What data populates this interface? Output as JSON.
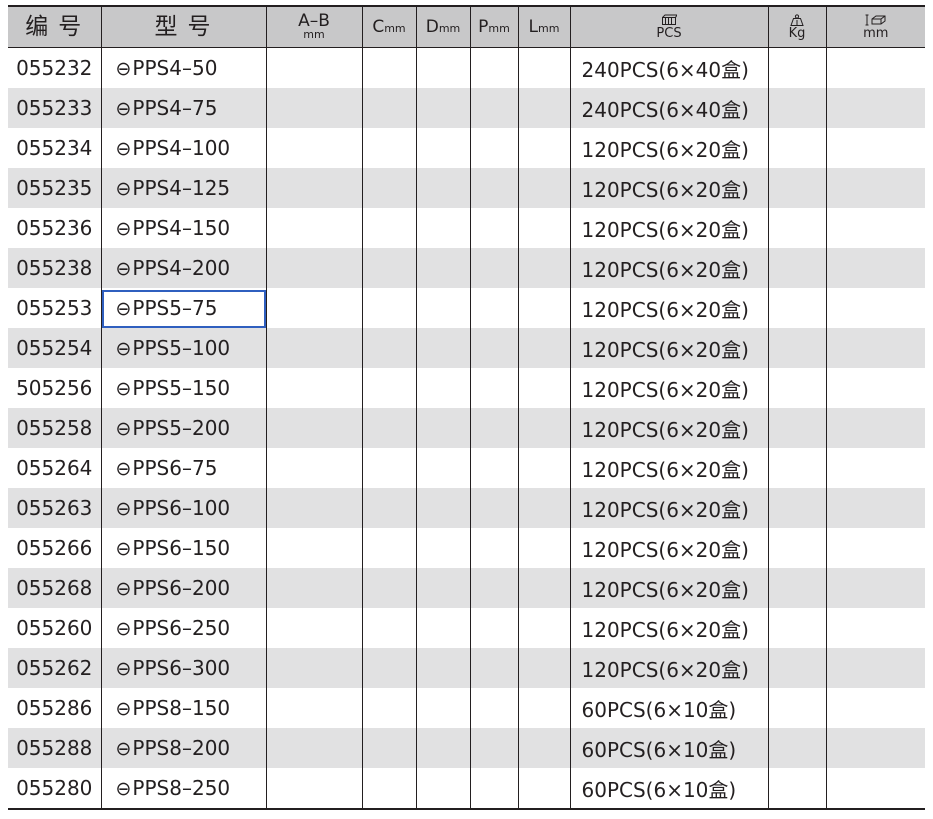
{
  "header": {
    "code": "编号",
    "model": "型号",
    "ab_main": "A–B",
    "ab_unit": "mm",
    "c_main": "C",
    "c_unit": "mm",
    "d_main": "D",
    "d_unit": "mm",
    "p_main": "P",
    "p_unit": "mm",
    "l_main": "L",
    "l_unit": "mm",
    "pcs_label": "PCS",
    "pcs_icon": "box-pack-icon",
    "kg_label": "Kg",
    "kg_icon": "weight-icon",
    "size_label": "mm",
    "size_icon": "carton-size-icon"
  },
  "model_symbol": "⊖",
  "rows": [
    {
      "code": "055232",
      "model": "PPS4–50",
      "ab": "",
      "c": "",
      "d": "",
      "p": "",
      "l": "",
      "pcs": "240PCS(6×40盒)",
      "kg": "",
      "size": ""
    },
    {
      "code": "055233",
      "model": "PPS4–75",
      "ab": "",
      "c": "",
      "d": "",
      "p": "",
      "l": "",
      "pcs": "240PCS(6×40盒)",
      "kg": "",
      "size": ""
    },
    {
      "code": "055234",
      "model": "PPS4–100",
      "ab": "",
      "c": "",
      "d": "",
      "p": "",
      "l": "",
      "pcs": "120PCS(6×20盒)",
      "kg": "",
      "size": ""
    },
    {
      "code": "055235",
      "model": "PPS4–125",
      "ab": "",
      "c": "",
      "d": "",
      "p": "",
      "l": "",
      "pcs": "120PCS(6×20盒)",
      "kg": "",
      "size": ""
    },
    {
      "code": "055236",
      "model": "PPS4–150",
      "ab": "",
      "c": "",
      "d": "",
      "p": "",
      "l": "",
      "pcs": "120PCS(6×20盒)",
      "kg": "",
      "size": ""
    },
    {
      "code": "055238",
      "model": "PPS4–200",
      "ab": "",
      "c": "",
      "d": "",
      "p": "",
      "l": "",
      "pcs": "120PCS(6×20盒)",
      "kg": "",
      "size": ""
    },
    {
      "code": "055253",
      "model": "PPS5–75",
      "ab": "",
      "c": "",
      "d": "",
      "p": "",
      "l": "",
      "pcs": "120PCS(6×20盒)",
      "kg": "",
      "size": ""
    },
    {
      "code": "055254",
      "model": "PPS5–100",
      "ab": "",
      "c": "",
      "d": "",
      "p": "",
      "l": "",
      "pcs": "120PCS(6×20盒)",
      "kg": "",
      "size": ""
    },
    {
      "code": "505256",
      "model": "PPS5–150",
      "ab": "",
      "c": "",
      "d": "",
      "p": "",
      "l": "",
      "pcs": "120PCS(6×20盒)",
      "kg": "",
      "size": ""
    },
    {
      "code": "055258",
      "model": "PPS5–200",
      "ab": "",
      "c": "",
      "d": "",
      "p": "",
      "l": "",
      "pcs": "120PCS(6×20盒)",
      "kg": "",
      "size": ""
    },
    {
      "code": "055264",
      "model": "PPS6–75",
      "ab": "",
      "c": "",
      "d": "",
      "p": "",
      "l": "",
      "pcs": "120PCS(6×20盒)",
      "kg": "",
      "size": ""
    },
    {
      "code": "055263",
      "model": "PPS6–100",
      "ab": "",
      "c": "",
      "d": "",
      "p": "",
      "l": "",
      "pcs": "120PCS(6×20盒)",
      "kg": "",
      "size": ""
    },
    {
      "code": "055266",
      "model": "PPS6–150",
      "ab": "",
      "c": "",
      "d": "",
      "p": "",
      "l": "",
      "pcs": "120PCS(6×20盒)",
      "kg": "",
      "size": ""
    },
    {
      "code": "055268",
      "model": "PPS6–200",
      "ab": "",
      "c": "",
      "d": "",
      "p": "",
      "l": "",
      "pcs": "120PCS(6×20盒)",
      "kg": "",
      "size": ""
    },
    {
      "code": "055260",
      "model": "PPS6–250",
      "ab": "",
      "c": "",
      "d": "",
      "p": "",
      "l": "",
      "pcs": "120PCS(6×20盒)",
      "kg": "",
      "size": ""
    },
    {
      "code": "055262",
      "model": "PPS6–300",
      "ab": "",
      "c": "",
      "d": "",
      "p": "",
      "l": "",
      "pcs": "120PCS(6×20盒)",
      "kg": "",
      "size": ""
    },
    {
      "code": "055286",
      "model": "PPS8–150",
      "ab": "",
      "c": "",
      "d": "",
      "p": "",
      "l": "",
      "pcs": "60PCS(6×10盒)",
      "kg": "",
      "size": ""
    },
    {
      "code": "055288",
      "model": "PPS8–200",
      "ab": "",
      "c": "",
      "d": "",
      "p": "",
      "l": "",
      "pcs": "60PCS(6×10盒)",
      "kg": "",
      "size": ""
    },
    {
      "code": "055280",
      "model": "PPS8–250",
      "ab": "",
      "c": "",
      "d": "",
      "p": "",
      "l": "",
      "pcs": "60PCS(6×10盒)",
      "kg": "",
      "size": ""
    }
  ],
  "selected_row_index": 6,
  "colors": {
    "header_bg": "#c8c8c9",
    "alt_row_bg": "#e1e1e2",
    "selection_border": "#2f5fbf",
    "text": "#231f20"
  }
}
